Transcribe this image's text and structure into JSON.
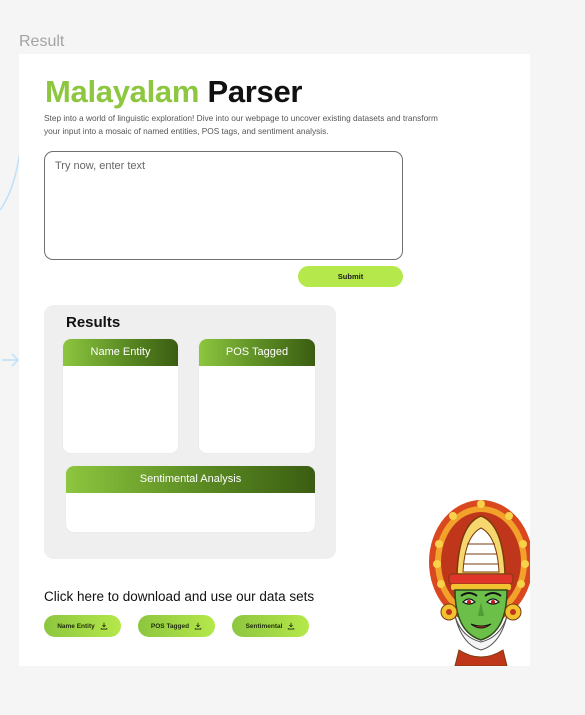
{
  "frame": {
    "label": "Result"
  },
  "header": {
    "title_accent": "Malayalam",
    "title_rest": "Parser",
    "intro": "Step into a world of linguistic exploration! Dive into our webpage to uncover existing datasets and transform your input into a mosaic of named entities, POS tags, and sentiment analysis."
  },
  "input": {
    "placeholder": "Try now, enter text",
    "value": ""
  },
  "submit": {
    "label": "Submit"
  },
  "results": {
    "title": "Results",
    "name_entity": {
      "label": "Name Entity"
    },
    "pos_tagged": {
      "label": "POS Tagged"
    },
    "sentiment": {
      "label": "Sentimental Analysis"
    }
  },
  "downloads": {
    "heading": "Click here to download and use our data sets",
    "buttons": [
      {
        "label": "Name Entity",
        "icon": "download-icon"
      },
      {
        "label": "POS Tagged",
        "icon": "download-icon"
      },
      {
        "label": "Sentimental",
        "icon": "download-icon"
      }
    ]
  },
  "colors": {
    "accent": "#8dc63f",
    "accent_light": "#b5e84a",
    "accent_dark": "#3b5d12",
    "connector": "#bfe0f6"
  }
}
